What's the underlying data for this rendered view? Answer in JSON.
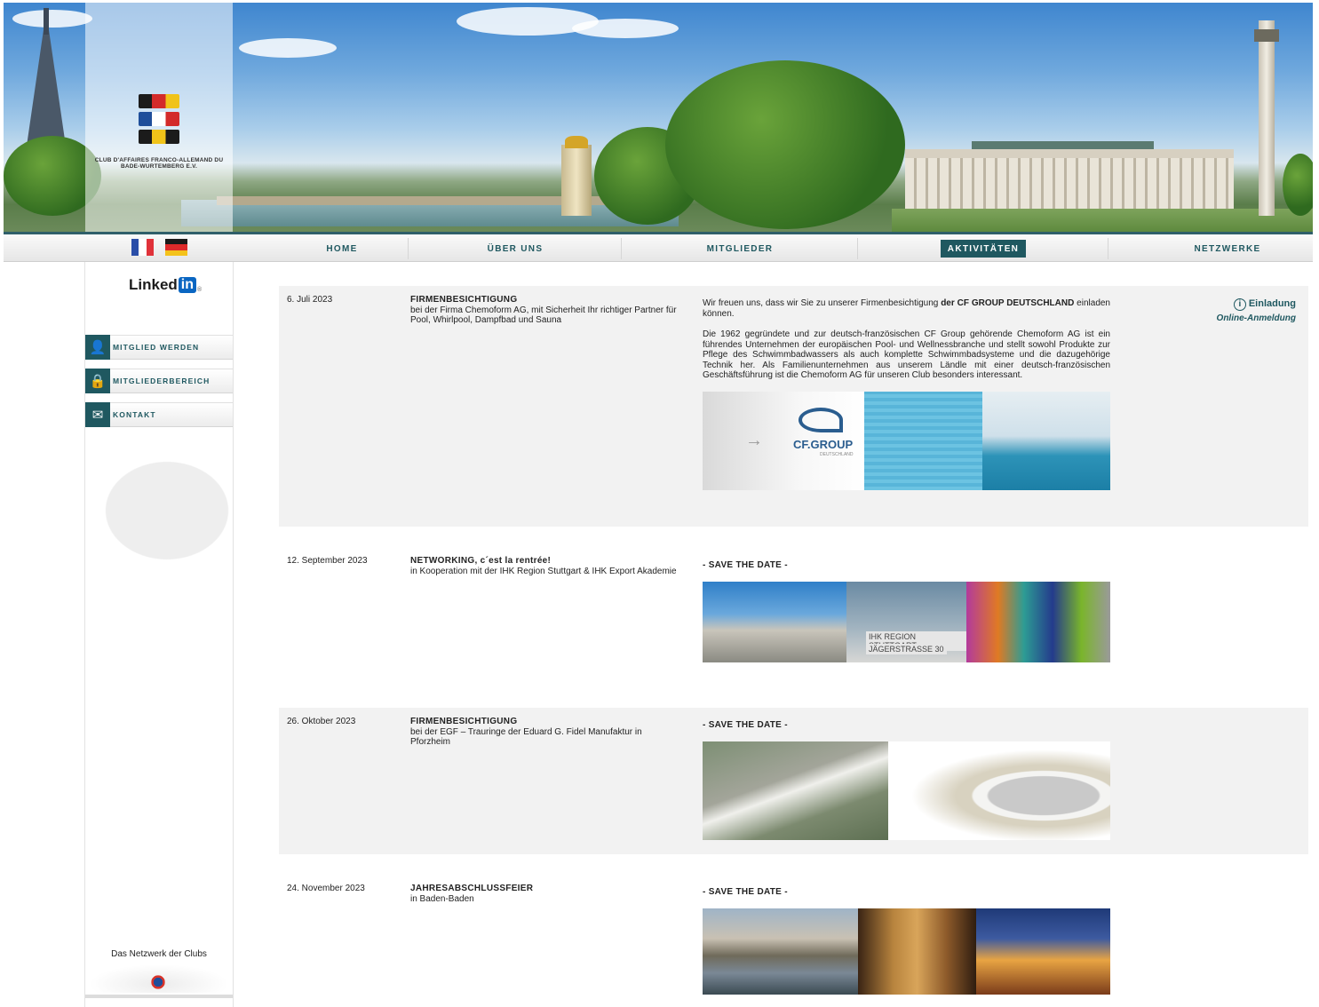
{
  "logo": {
    "text": "CLUB D'AFFAIRES FRANCO-ALLEMAND DU BADE-WURTEMBERG E.V."
  },
  "nav": {
    "items": [
      {
        "label": "Home"
      },
      {
        "label": "Über uns"
      },
      {
        "label": "Mitglieder"
      },
      {
        "label": "Aktivitäten"
      },
      {
        "label": "Netzwerke"
      }
    ],
    "active": "Aktivitäten"
  },
  "sidebar": {
    "linkedin_text": "Linked",
    "linkedin_badge": "in",
    "buttons": [
      {
        "label": "Mitglied werden",
        "icon": "person-add-icon"
      },
      {
        "label": "Mitgliederbereich",
        "icon": "lock-icon"
      },
      {
        "label": "Kontakt",
        "icon": "envelope-icon"
      }
    ],
    "footer_text": "Das Netzwerk der Clubs"
  },
  "colors": {
    "accent": "#1f5860",
    "row_bg": "#f2f2f2"
  },
  "events": [
    {
      "date": "6. Juli 2023",
      "title": "FIRMENBESICHTIGUNG",
      "subtitle": "bei der Firma Chemoform AG, mit Sicherheit Ihr richtiger Partner für Pool, Whirlpool, Dampfbad und Sauna",
      "text1_a": "Wir freuen uns, dass wir Sie zu unserer Firmenbesichtigung ",
      "text1_b": "der CF GROUP DEUTSCHLAND",
      "text1_c": " einladen können.",
      "text2": "Die 1962 gegründete und zur deutsch-französischen CF Group gehörende Chemoform AG ist ein führendes Unternehmen der europäischen Pool- und Wellnessbranche und stellt sowohl Produkte zur Pflege des Schwimmbadwassers als auch komplette Schwimmbadsysteme und die dazugehörige Technik her. Als Familienunternehmen aus unserem Ländle mit einer deutsch-französischen Geschäftsführung ist die Chemoform AG für unseren Club besonders interessant.",
      "invite_label": "Einladung",
      "online_label": "Online-Anmeldung",
      "image_logo": "CF.GROUP",
      "image_logo_sub": "DEUTSCHLAND"
    },
    {
      "date": "12. September 2023",
      "title": "NETWORKING, c´est la rentrée!",
      "subtitle": "in Kooperation mit der IHK Region Stuttgart & IHK Export Akademie",
      "save": "- SAVE THE DATE -",
      "image_sign_1": "IHK REGION STUTTGART",
      "image_sign_2": "JÄGERSTRASSE 30"
    },
    {
      "date": "26. Oktober 2023",
      "title": "FIRMENBESICHTIGUNG",
      "subtitle": "bei der EGF – Trauringe der Eduard G. Fidel Manufaktur in Pforzheim",
      "save": "- SAVE THE DATE -"
    },
    {
      "date": "24. November 2023",
      "title": "JAHRESABSCHLUSSFEIER",
      "subtitle": "in Baden-Baden",
      "save": "- SAVE THE DATE -"
    }
  ]
}
